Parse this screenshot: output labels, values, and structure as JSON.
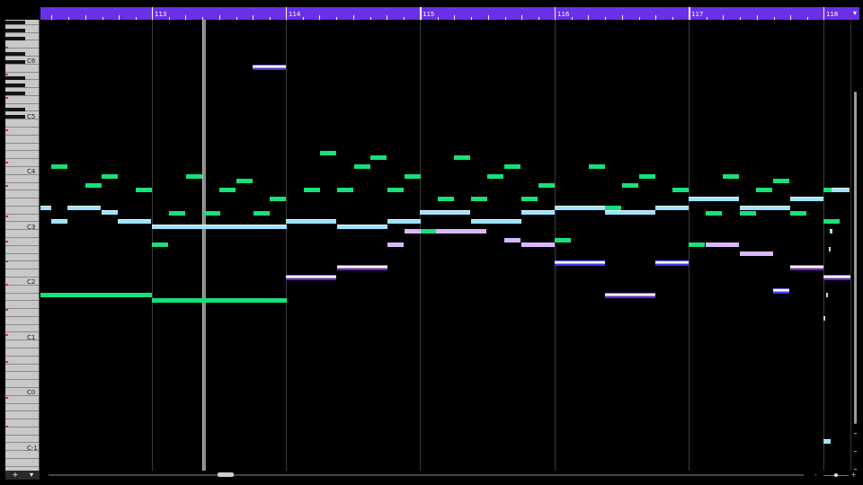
{
  "ruler": {
    "bars": [
      "113",
      "114",
      "115",
      "116",
      "117",
      "118"
    ],
    "menu_icon": "triangle-down-icon"
  },
  "keyboard": {
    "octave_labels": [
      "C6",
      "C5",
      "C4",
      "C3",
      "C2",
      "C1",
      "C0",
      "C-1"
    ],
    "add_label": "+",
    "menu_label": "▾"
  },
  "colors": {
    "ruler": "#6a30e8",
    "note_green": "#18e07a",
    "note_blue": "#9fe2ff",
    "note_lavender": "#d9b8ff",
    "note_selected_accent": "#3b36ff"
  },
  "scroll": {
    "zoom_minus": "-",
    "zoom_plus": "+"
  }
}
